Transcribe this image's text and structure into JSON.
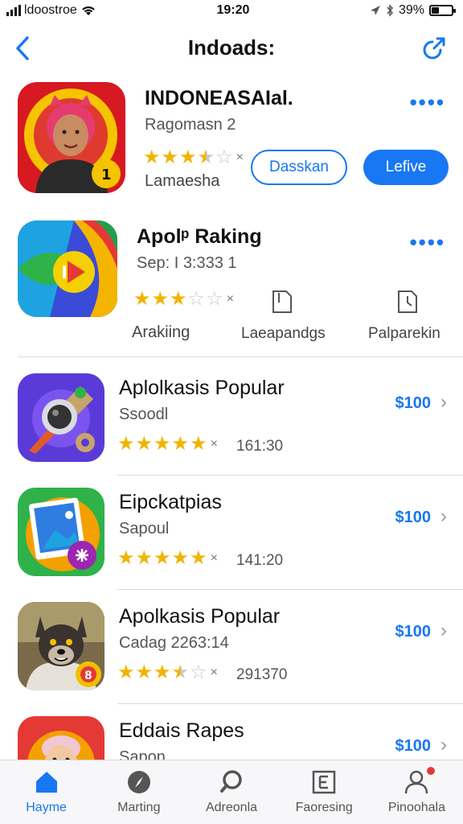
{
  "status": {
    "carrier": "ldoostroe",
    "time": "19:20",
    "battery_text": "39%",
    "battery_level": 0.39
  },
  "nav": {
    "title": "Indoads:"
  },
  "featured": [
    {
      "title": "INDONEASAIal.",
      "subtitle": "Ragomasn 2",
      "rating": 3.5,
      "rating_label": "Lamaesha",
      "button_outline": "Dasskan",
      "button_fill": "Lefive"
    },
    {
      "title": "Apolᵖ Raking",
      "subtitle": "Sep: I 3:333 1",
      "rating": 3,
      "rating_label": "Arakiing",
      "actions": [
        {
          "label": "Laeapandgs",
          "icon": "document-icon"
        },
        {
          "label": "Palparekin",
          "icon": "clock-document-icon"
        }
      ]
    }
  ],
  "list": [
    {
      "title": "Aplolkasis Popular",
      "subtitle": "Ssoodl",
      "rating": 5,
      "meta": "161:30",
      "price": "$100",
      "icon": "camera-tools-icon"
    },
    {
      "title": "Eipckatpias",
      "subtitle": "Sapoul",
      "rating": 5,
      "meta": "141:20",
      "price": "$100",
      "icon": "photo-frame-icon"
    },
    {
      "title": "Apolkasis Popular",
      "subtitle": "Cadag 2263:14",
      "rating": 3.5,
      "meta": "291370",
      "price": "$100",
      "icon": "dog-avatar-icon"
    },
    {
      "title": "Eddais Rapes",
      "subtitle": "Sapon",
      "price": "$100",
      "icon": "person-avatar-icon"
    }
  ],
  "tabs": [
    {
      "label": "Hayme",
      "icon": "home-icon",
      "active": true
    },
    {
      "label": "Marting",
      "icon": "compass-icon",
      "active": false
    },
    {
      "label": "Adreonla",
      "icon": "search-icon",
      "active": false
    },
    {
      "label": "Faoresing",
      "icon": "news-icon",
      "active": false
    },
    {
      "label": "Pinoohala",
      "icon": "profile-icon",
      "active": false,
      "badge": true
    }
  ],
  "colors": {
    "accent": "#1877f2",
    "star": "#f2b400"
  }
}
